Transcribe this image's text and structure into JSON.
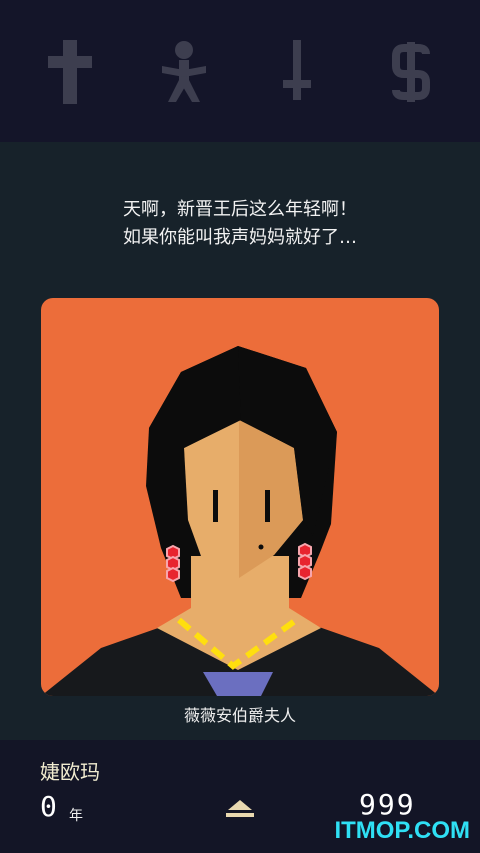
{
  "stats": [
    {
      "name": "church",
      "icon": "cross-icon",
      "color": "#3d3e4f"
    },
    {
      "name": "people",
      "icon": "person-icon",
      "color": "#3d3e4f"
    },
    {
      "name": "army",
      "icon": "sword-icon",
      "color": "#3d3e4f"
    },
    {
      "name": "treasury",
      "icon": "dollar-icon",
      "color": "#3d3e4f"
    }
  ],
  "dialogue": {
    "line1": "天啊，新晋王后这么年轻啊！",
    "line2": "如果你能叫我声妈妈就好了…"
  },
  "card": {
    "character_name": "薇薇安伯爵夫人",
    "background_color": "#ec6d3a"
  },
  "ruler": {
    "name": "婕欧玛",
    "years_value": "0",
    "years_unit": "年"
  },
  "score": "999",
  "watermark": "ITMOP.COM"
}
